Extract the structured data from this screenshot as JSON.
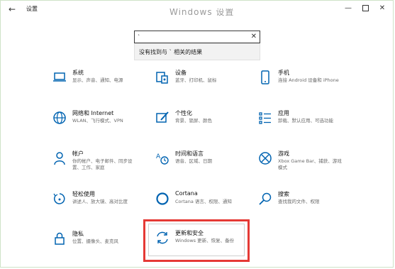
{
  "window": {
    "title": "设置",
    "ghost_heading": "Windows 设置",
    "back_glyph": "←",
    "min_glyph": "—",
    "close_glyph": "✕"
  },
  "search": {
    "value": "`",
    "clear_glyph": "✕",
    "no_result": "没有找到与 ` 相关的结果"
  },
  "items": [
    {
      "title": "系统",
      "desc": "显示、声音、通知、电源",
      "icon": "laptop-icon"
    },
    {
      "title": "设备",
      "desc": "蓝牙、打印机、鼠标",
      "icon": "devices-icon"
    },
    {
      "title": "手机",
      "desc": "连接 Android 设备和 iPhone",
      "icon": "phone-icon"
    },
    {
      "title": "网络和 Internet",
      "desc": "WLAN、飞行模式、VPN",
      "icon": "globe-icon"
    },
    {
      "title": "个性化",
      "desc": "背景、锁屏、颜色",
      "icon": "paint-icon"
    },
    {
      "title": "应用",
      "desc": "卸载、默认应用、可选功能",
      "icon": "apps-icon"
    },
    {
      "title": "帐户",
      "desc": "你的帐户、电子邮件、同步设置、工作、家庭",
      "icon": "person-icon"
    },
    {
      "title": "时间和语言",
      "desc": "语音、区域、日期",
      "icon": "time-language-icon"
    },
    {
      "title": "游戏",
      "desc": "Xbox Game Bar、捕获、游戏模式",
      "icon": "xbox-icon"
    },
    {
      "title": "轻松使用",
      "desc": "讲述人、放大镜、高对比度",
      "icon": "accessibility-icon"
    },
    {
      "title": "Cortana",
      "desc": "Cortana 语言、权限、通知",
      "icon": "cortana-icon"
    },
    {
      "title": "搜索",
      "desc": "查找我的文件、权限",
      "icon": "search-icon"
    },
    {
      "title": "隐私",
      "desc": "位置、摄像头、麦克风",
      "icon": "lock-icon"
    },
    {
      "title": "更新和安全",
      "desc": "Windows 更新、恢复、备份",
      "icon": "update-icon"
    }
  ],
  "colors": {
    "accent": "#0063b1",
    "highlight": "#e53935"
  }
}
